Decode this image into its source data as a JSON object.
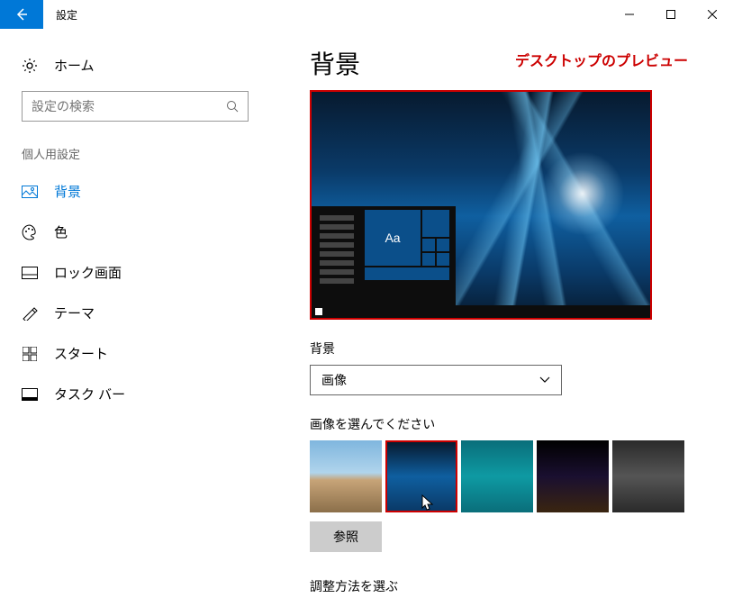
{
  "titlebar": {
    "title": "設定"
  },
  "sidebar": {
    "home": "ホーム",
    "search_placeholder": "設定の検索",
    "section_label": "個人用設定",
    "items": [
      {
        "label": "背景"
      },
      {
        "label": "色"
      },
      {
        "label": "ロック画面"
      },
      {
        "label": "テーマ"
      },
      {
        "label": "スタート"
      },
      {
        "label": "タスク バー"
      }
    ]
  },
  "main": {
    "page_title": "背景",
    "annotation": "デスクトップのプレビュー",
    "preview_tile_text": "Aa",
    "bg_label": "背景",
    "bg_dropdown_value": "画像",
    "choose_label": "画像を選んでください",
    "browse_label": "参照",
    "fit_label": "調整方法を選ぶ"
  }
}
